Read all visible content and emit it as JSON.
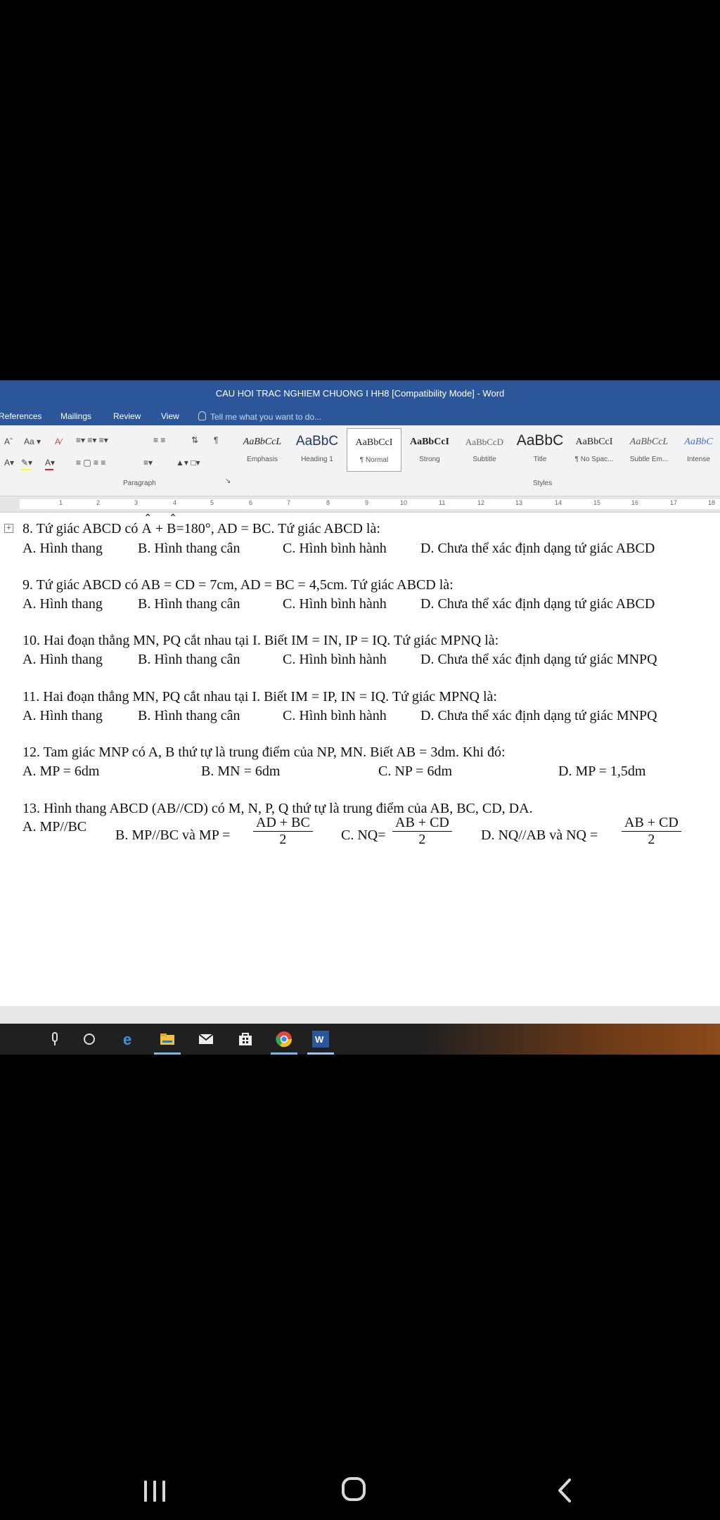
{
  "window": {
    "title": "CAU HOI TRAC NGHIEM CHUONG I HH8 [Compatibility Mode] - Word"
  },
  "tabs": [
    "References",
    "Mailings",
    "Review",
    "View"
  ],
  "tell_me": "Tell me what you want to do...",
  "ribbon": {
    "paragraph_label": "Paragraph",
    "styles_label": "Styles",
    "styles": [
      {
        "sample": "AaBbCcL",
        "name": "Emphasis"
      },
      {
        "sample": "AaBbC",
        "name": "Heading 1"
      },
      {
        "sample": "AaBbCcI",
        "name": "¶ Normal"
      },
      {
        "sample": "AaBbCcI",
        "name": "Strong"
      },
      {
        "sample": "AaBbCcD",
        "name": "Subtitle"
      },
      {
        "sample": "AaBbC",
        "name": "Title"
      },
      {
        "sample": "AaBbCcI",
        "name": "¶ No Spac..."
      },
      {
        "sample": "AaBbCcL",
        "name": "Subtle Em..."
      },
      {
        "sample": "AaBbC",
        "name": "Intense"
      }
    ]
  },
  "ruler_numbers": [
    "1",
    "2",
    "3",
    "4",
    "5",
    "6",
    "7",
    "8",
    "9",
    "10",
    "11",
    "12",
    "13",
    "14",
    "15",
    "16",
    "17",
    "18"
  ],
  "questions": {
    "q8": {
      "pre": "8. Tứ giác ABCD có",
      "angle_a": "A",
      "plus": "+",
      "angle_b": "B",
      "post": "=180°, AD = BC. Tứ giác ABCD là:",
      "a": "A. Hình thang",
      "b": "B. Hình thang cân",
      "c": "C. Hình bình hành",
      "d": "D. Chưa thể xác định dạng tứ giác ABCD"
    },
    "q9": {
      "text": "9. Tứ giác ABCD có AB = CD = 7cm, AD = BC = 4,5cm. Tứ giác ABCD là:",
      "a": "A. Hình thang",
      "b": "B. Hình thang cân",
      "c": "C. Hình bình hành",
      "d": "D. Chưa thể xác định dạng tứ giác ABCD"
    },
    "q10": {
      "text": "10. Hai đoạn thẳng MN, PQ cắt nhau tại I. Biết IM = IN, IP = IQ. Tứ  giác MPNQ là:",
      "a": "A. Hình thang",
      "b": "B. Hình thang cân",
      "c": "C. Hình bình hành",
      "d": "D. Chưa thể xác định dạng tứ giác MNPQ"
    },
    "q11": {
      "text": "11. Hai đoạn thẳng MN, PQ cắt nhau  tại I. Biết IM = IP, IN = IQ. Tứ giác MPNQ là:",
      "a": "A. Hình thang",
      "b": "B. Hình thang cân",
      "c": "C. Hình bình hành",
      "d": "D. Chưa thể xác định dạng tứ giác MNPQ"
    },
    "q12": {
      "text": "12. Tam giác MNP có A, B thứ tự là trung điểm của NP, MN. Biết AB = 3dm. Khi đó:",
      "a": "A. MP = 6dm",
      "b": "B. MN = 6dm",
      "c": "C. NP = 6dm",
      "d": "D. MP = 1,5dm"
    },
    "q13": {
      "text": "13. Hình thang ABCD (AB//CD) có M, N, P, Q thứ tự là trung điểm của AB, BC, CD, DA.",
      "a": "A. MP//BC",
      "b_pre": "B. MP//BC và MP =",
      "b_num": "AD + BC",
      "b_den": "2",
      "c_pre": "C. NQ=",
      "c_num": "AB + CD",
      "c_den": "2",
      "d_pre": "D. NQ//AB  và NQ =",
      "d_num": "AB + CD",
      "d_den": "2"
    }
  },
  "colors": {
    "word_blue": "#2b579a",
    "taskbar": "#202020"
  },
  "taskbar_icons": [
    "microphone-icon",
    "task-view-icon",
    "edge-icon",
    "file-explorer-icon",
    "mail-icon",
    "store-icon",
    "chrome-icon",
    "word-icon"
  ],
  "nav_icons": [
    "recent-apps-icon",
    "home-icon",
    "back-icon"
  ]
}
